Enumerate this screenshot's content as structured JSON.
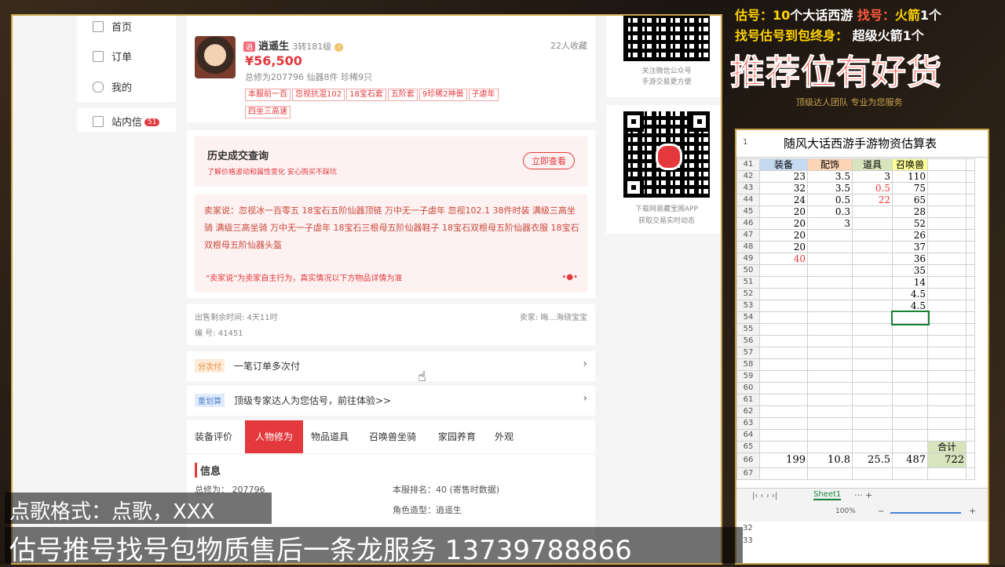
{
  "banner": {
    "line1a": "估号：",
    "line1b": "10",
    "line1c": "个大话西游",
    "line1d": "找号：",
    "line1e": "火箭",
    "line1f": "1",
    "line1g": "个",
    "line2a": "找号估号到包终身：",
    "line2b": "超级火箭",
    "line2c": "1",
    "line2d": "个",
    "recommend": "推荐位有好货",
    "sub": "顶级达人团队 专业为您服务"
  },
  "nav": {
    "home": "首页",
    "orders": "订单",
    "mine": "我的",
    "inbox": "站内信",
    "inbox_badge": "51"
  },
  "item": {
    "seller_icon": "逍",
    "name": "逍遥生",
    "level": "3转181级",
    "favorites": "22人收藏",
    "price": "¥56,500",
    "stats": "总修为207796  仙器8件  珍稀9只",
    "tags": [
      "本服前一百",
      "忽视抗混102",
      "18宝石套",
      "五阶套",
      "9珍稀2神兽",
      "子虐年",
      "四坐三高速"
    ]
  },
  "history": {
    "title": "历史成交查询",
    "sub": "了解价格波动和属性变化    安心购买不踩坑",
    "button": "立即查看"
  },
  "seller_says": {
    "text": "卖家说：忽视冰一百零五 18宝石五阶仙器顶链 万中无一子虐年 忽视102.1 38件时装 满级三高坐骑 满级三高坐骑 万中无一子虐年 18宝石三根母五阶仙器鞋子 18宝石双根母五阶仙器衣服 18宝石双根母五阶仙器头盔",
    "note": "“卖家说”为卖家自主行为，真实情况以下方物品详情为准"
  },
  "meta": {
    "time_left": "出售剩余时间: 4天11时",
    "serial": "编 号: 41451",
    "seller": "卖家: 晦...海绕宝宝"
  },
  "installment": {
    "badge": "分次付",
    "text": "一笔订单多次付"
  },
  "plan": {
    "badge": "重划算",
    "text": "顶级专家达人为您估号，前往体验>>"
  },
  "tabs": [
    "装备评价",
    "人物修为",
    "物品道具",
    "召唤兽坐骑",
    "家园养育",
    "外观"
  ],
  "active_tab": 1,
  "info": {
    "title": "信息",
    "cultivation": "总修为：  207796",
    "rank": "本服排名：40 (寄售时数据)",
    "role": "角色造型：逍遥生"
  },
  "qr1_caption": "关注微信公众号\n手游交易更方便",
  "qr2_caption": "下载网易藏宝阁APP\n获取交易实时动态",
  "sheet": {
    "title": "随风大话西游手游物资估算表",
    "headers": [
      "装备",
      "配饰",
      "道具",
      "召唤兽"
    ],
    "rows": [
      {
        "n": "42",
        "v": [
          "23",
          "3.5",
          "3",
          "110"
        ]
      },
      {
        "n": "43",
        "v": [
          "32",
          "3.5",
          "0.5",
          "75"
        ]
      },
      {
        "n": "44",
        "v": [
          "24",
          "0.5",
          "22",
          "65"
        ]
      },
      {
        "n": "45",
        "v": [
          "20",
          "0.3",
          "",
          "28"
        ]
      },
      {
        "n": "46",
        "v": [
          "20",
          "3",
          "",
          "52"
        ]
      },
      {
        "n": "47",
        "v": [
          "20",
          "",
          "",
          "26"
        ]
      },
      {
        "n": "48",
        "v": [
          "20",
          "",
          "",
          "37"
        ]
      },
      {
        "n": "49",
        "v": [
          "40",
          "",
          "",
          "36"
        ]
      },
      {
        "n": "50",
        "v": [
          "",
          "",
          "",
          "35"
        ]
      },
      {
        "n": "51",
        "v": [
          "",
          "",
          "",
          "14"
        ]
      },
      {
        "n": "52",
        "v": [
          "",
          "",
          "",
          "4.5"
        ]
      },
      {
        "n": "53",
        "v": [
          "",
          "",
          "",
          "4.5"
        ]
      },
      {
        "n": "54",
        "v": [
          "",
          "",
          "",
          ""
        ]
      },
      {
        "n": "55",
        "v": [
          "",
          "",
          "",
          ""
        ]
      },
      {
        "n": "56",
        "v": [
          "",
          "",
          "",
          ""
        ]
      },
      {
        "n": "57",
        "v": [
          "",
          "",
          "",
          ""
        ]
      },
      {
        "n": "58",
        "v": [
          "",
          "",
          "",
          ""
        ]
      },
      {
        "n": "59",
        "v": [
          "",
          "",
          "",
          ""
        ]
      },
      {
        "n": "60",
        "v": [
          "",
          "",
          "",
          ""
        ]
      },
      {
        "n": "61",
        "v": [
          "",
          "",
          "",
          ""
        ]
      },
      {
        "n": "62",
        "v": [
          "",
          "",
          "",
          ""
        ]
      },
      {
        "n": "63",
        "v": [
          "",
          "",
          "",
          ""
        ]
      },
      {
        "n": "64",
        "v": [
          "",
          "",
          "",
          ""
        ]
      }
    ],
    "total_label": "合计",
    "totals_row": "66",
    "totals": [
      "199",
      "10.8",
      "25.5",
      "487",
      "722"
    ],
    "row65": "65",
    "row67": "67",
    "row1": "1",
    "row41": "41",
    "tab": "Sheet1",
    "zoom": "100%",
    "row32": "32",
    "row33": "33"
  },
  "song_format": "点歌格式：点歌，XXX",
  "service_line": "估号推号找号包物质售后一条龙服务 13739788866",
  "colors": {
    "accent": "#e4393c",
    "gold": "#c9a34c",
    "sheet_green": "#d8e4bc"
  }
}
